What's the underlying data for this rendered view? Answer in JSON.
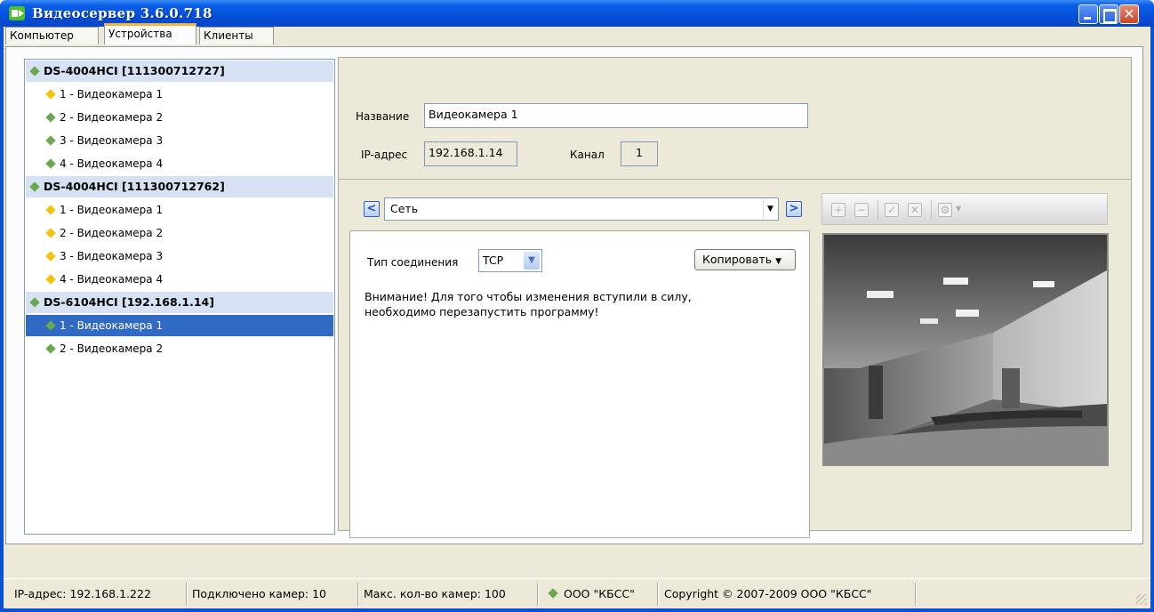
{
  "window": {
    "title": "Видеосервер 3.6.0.718"
  },
  "tabs": [
    {
      "label": "Компьютер",
      "active": false
    },
    {
      "label": "Устройства",
      "active": true
    },
    {
      "label": "Клиенты",
      "active": false
    }
  ],
  "tree": {
    "groups": [
      {
        "label": "DS-4004HCI [111300712727]",
        "items": [
          {
            "label": "1 - Видеокамера 1",
            "status": "yellow"
          },
          {
            "label": "2 - Видеокамера 2",
            "status": "green"
          },
          {
            "label": "3 - Видеокамера 3",
            "status": "green"
          },
          {
            "label": "4 - Видеокамера 4",
            "status": "green"
          }
        ]
      },
      {
        "label": "DS-4004HCI [111300712762]",
        "items": [
          {
            "label": "1 - Видеокамера 1",
            "status": "yellow"
          },
          {
            "label": "2 - Видеокамера 2",
            "status": "yellow"
          },
          {
            "label": "3 - Видеокамера 3",
            "status": "yellow"
          },
          {
            "label": "4 - Видеокамера 4",
            "status": "yellow"
          }
        ]
      },
      {
        "label": "DS-6104HCI [192.168.1.14]",
        "items": [
          {
            "label": "1 - Видеокамера 1",
            "status": "green",
            "selected": true
          },
          {
            "label": "2 - Видеокамера 2",
            "status": "green"
          }
        ]
      }
    ]
  },
  "details": {
    "name_label": "Название",
    "name_value": "Видеокамера 1",
    "ip_label": "IP-адрес",
    "ip_value": "192.168.1.14",
    "channel_label": "Канал",
    "channel_value": "1"
  },
  "section_selector": {
    "value": "Сеть",
    "prev_icon": "chevron-left-icon",
    "next_icon": "chevron-right-icon"
  },
  "settings": {
    "connection_label": "Тип соединения",
    "connection_value": "TCP",
    "copy_button": "Копировать",
    "warning_line1": "Внимание! Для того чтобы изменения вступили в силу,",
    "warning_line2": "необходимо перезапустить программу!"
  },
  "camera_toolbar": [
    "add-icon",
    "remove-icon",
    "apply-icon",
    "cancel-icon",
    "settings-icon"
  ],
  "statusbar": {
    "ip": "IP-адрес: 192.168.1.222",
    "connected": "Подключено камер: 10",
    "max": "Макс. кол-во камер: 100",
    "company": "ООО \"КБСС\"",
    "copyright": "Copyright © 2007-2009 ООО \"КБСС\""
  },
  "colors": {
    "status_green": "#6aa84f",
    "status_yellow": "#f4c20d",
    "selection": "#316ac5",
    "titlebar": "#0450db"
  }
}
